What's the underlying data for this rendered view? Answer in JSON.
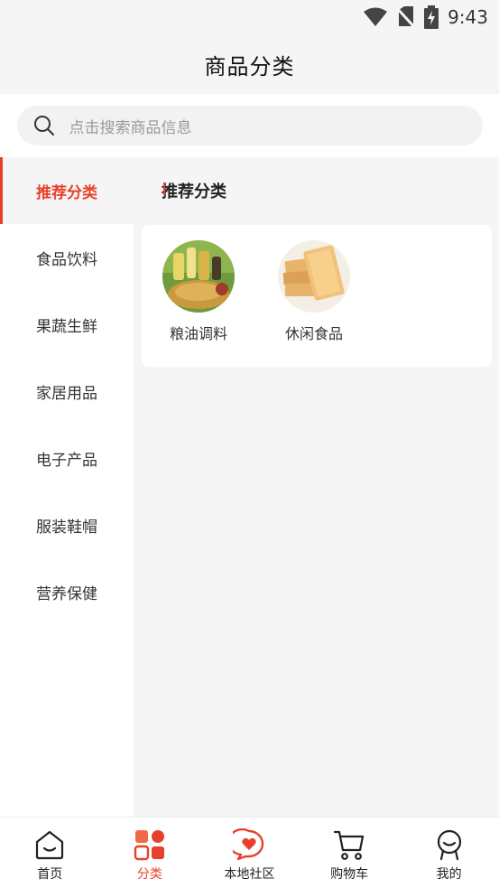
{
  "status_bar": {
    "time": "9:43",
    "icons": [
      "wifi-icon",
      "no-sim-icon",
      "battery-charging-icon"
    ]
  },
  "header": {
    "title": "商品分类"
  },
  "search": {
    "placeholder": "点击搜索商品信息",
    "icon": "search-icon"
  },
  "sidebar": {
    "items": [
      {
        "label": "推荐分类",
        "active": true
      },
      {
        "label": "食品饮料",
        "active": false
      },
      {
        "label": "果蔬生鲜",
        "active": false
      },
      {
        "label": "家居用品",
        "active": false
      },
      {
        "label": "电子产品",
        "active": false
      },
      {
        "label": "服装鞋帽",
        "active": false
      },
      {
        "label": "营养保健",
        "active": false
      }
    ]
  },
  "content": {
    "section_title": "推荐分类",
    "categories": [
      {
        "label": "粮油调料",
        "image": "grain-oil-photo"
      },
      {
        "label": "休闲食品",
        "image": "snack-biscuit-photo"
      }
    ]
  },
  "tabbar": {
    "tabs": [
      {
        "label": "首页",
        "icon": "home-face-icon",
        "active": false
      },
      {
        "label": "分类",
        "icon": "category-grid-icon",
        "active": true
      },
      {
        "label": "本地社区",
        "icon": "community-heart-icon",
        "active": false
      },
      {
        "label": "购物车",
        "icon": "cart-icon",
        "active": false
      },
      {
        "label": "我的",
        "icon": "profile-icon",
        "active": false
      }
    ]
  },
  "colors": {
    "accent": "#e8412b",
    "background": "#f5f5f5",
    "card": "#ffffff"
  }
}
